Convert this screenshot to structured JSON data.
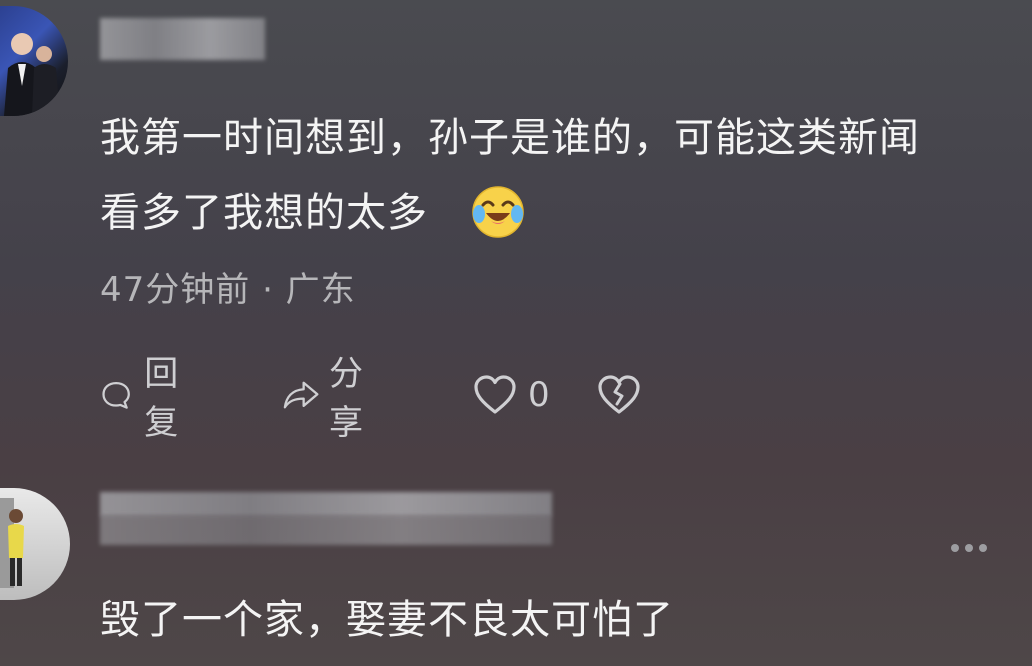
{
  "comments": [
    {
      "author_name": "",
      "text_line1": "我第一时间想到，孙子是谁的，可能这类新闻",
      "text_line2": "看多了我想的太多",
      "emoji": "crying-laughing-face",
      "meta": "47分钟前 · 广东",
      "actions": {
        "reply_label": "回复",
        "share_label": "分享",
        "like_count": "0"
      }
    },
    {
      "author_name": "",
      "text": "毁了一个家，娶妻不良太可怕了"
    }
  ],
  "icons": [
    "comment-bubble-icon",
    "share-arrow-icon",
    "heart-icon",
    "broken-heart-icon",
    "more-dots-icon"
  ],
  "colors": {
    "text": "#f4f4f4",
    "meta": "#b6b6b9",
    "icon": "#cfcfd2"
  }
}
